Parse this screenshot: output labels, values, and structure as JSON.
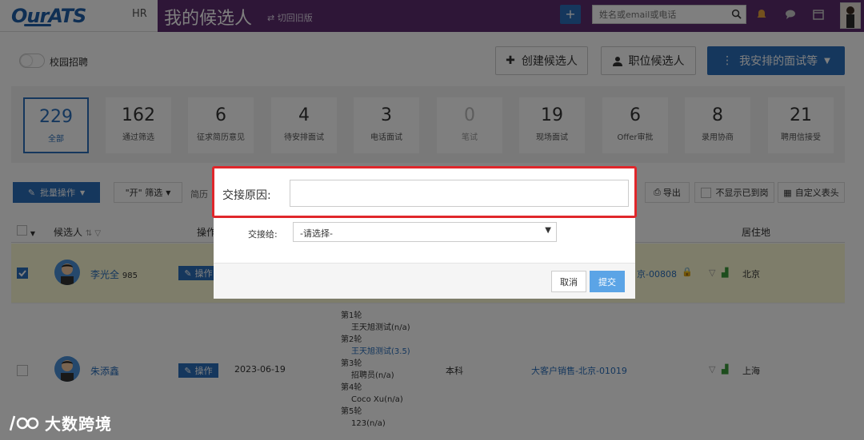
{
  "header": {
    "logo": "OurATS",
    "role": "HR",
    "page_title": "我的候选人",
    "switch_old": "切回旧版",
    "search_placeholder": "姓名或email或电话",
    "accent_color": "#5c2d6e"
  },
  "toolbar_top": {
    "campus_toggle_label": "校园招聘",
    "create_candidate": "创建候选人",
    "position_candidate": "职位候选人",
    "my_interviews": "我安排的面试等"
  },
  "stats": [
    {
      "count": "229",
      "label": "全部"
    },
    {
      "count": "162",
      "label": "通过筛选"
    },
    {
      "count": "6",
      "label": "征求简历意见"
    },
    {
      "count": "4",
      "label": "待安排面试"
    },
    {
      "count": "3",
      "label": "电话面试"
    },
    {
      "count": "0",
      "label": "笔试"
    },
    {
      "count": "19",
      "label": "现场面试"
    },
    {
      "count": "6",
      "label": "Offer审批"
    },
    {
      "count": "8",
      "label": "录用协商"
    },
    {
      "count": "21",
      "label": "聘用信接受"
    }
  ],
  "list_toolbar": {
    "bulk_action": "批量操作",
    "filter": "\"开\" 筛选",
    "resume_partial": "简历",
    "export": "导出",
    "hide_arrived": "不显示已到岗",
    "custom_columns": "自定义表头"
  },
  "table": {
    "columns": {
      "candidate": "候选人",
      "actions": "操作",
      "residence": "居住地"
    },
    "rows": [
      {
        "name": "李光全",
        "tag": "985",
        "action": "操作",
        "position": "京-00808",
        "residence": "北京"
      },
      {
        "name": "朱添鑫",
        "action": "操作",
        "date": "2023-06-19",
        "rounds": [
          {
            "round": "第1轮",
            "interviewer": "王天旭测试(n/a)"
          },
          {
            "round": "第2轮",
            "interviewer": "王天旭测试(3.5)"
          },
          {
            "round": "第3轮",
            "interviewer": "招聘员(n/a)"
          },
          {
            "round": "第4轮",
            "interviewer": "Coco Xu(n/a)"
          },
          {
            "round": "第5轮",
            "interviewer": "123(n/a)"
          }
        ],
        "education": "本科",
        "position": "大客户销售-北京-01019",
        "residence": "上海"
      }
    ]
  },
  "modal": {
    "reason_label": "交接原因:",
    "reason_value": "",
    "assign_label": "交接给:",
    "assign_selected": "-请选择-",
    "cancel": "取消",
    "submit": "提交",
    "highlight_color": "#e0272b"
  },
  "watermark": {
    "text": "大数跨境"
  }
}
